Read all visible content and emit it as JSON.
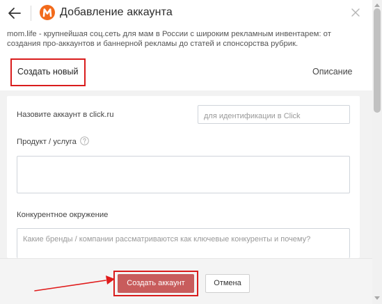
{
  "header": {
    "title": "Добавление аккаунта",
    "back_icon": "arrow-left-icon",
    "close_icon": "close-icon",
    "logo_letter": "M",
    "logo_color": "#f26a1b"
  },
  "description": "mom.life - крупнейшая соц.сеть для мам в России с широким рекламным инвентарем: от создания про-аккаунтов и баннерной рекламы до статей и спонсорства рубрик.",
  "tabs": {
    "create_label": "Создать новый",
    "description_label": "Описание"
  },
  "form": {
    "account_name_label": "Назовите аккаунт в click.ru",
    "account_name_placeholder": "для идентификации в Click",
    "product_label": "Продукт / услуга",
    "product_value": "",
    "competitors_label": "Конкурентное окружение",
    "competitors_placeholder": "Какие бренды / компании рассматриваются как ключевые конкуренты и почему?"
  },
  "footer": {
    "create_button": "Создать аккаунт",
    "cancel_button": "Отмена"
  },
  "colors": {
    "accent_red": "#d91c1c",
    "primary_button": "#c85c5c",
    "brand_orange": "#f26a1b"
  }
}
